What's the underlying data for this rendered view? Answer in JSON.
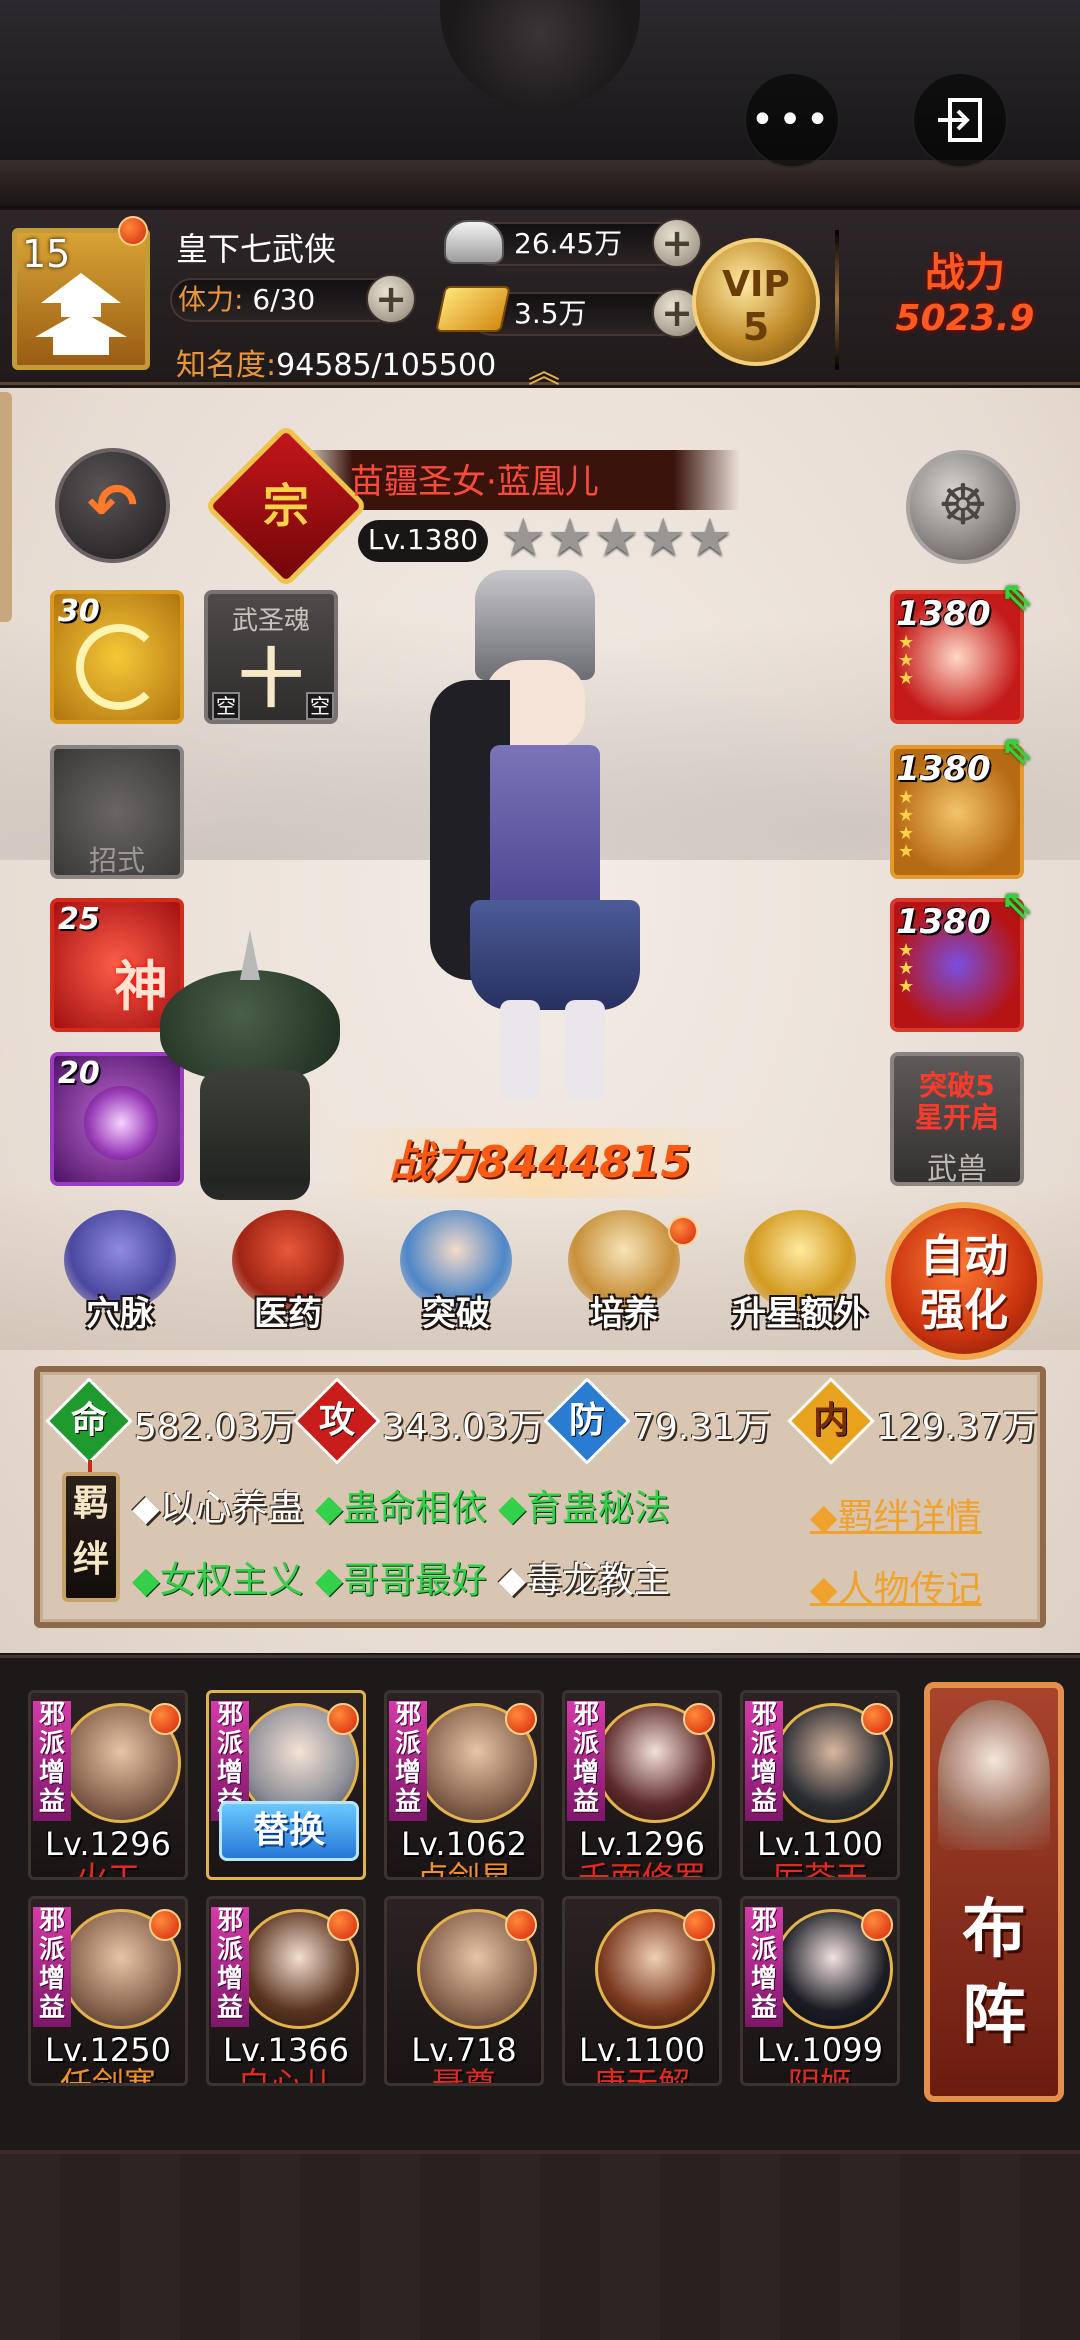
{
  "header": {
    "menu_icon": "more-dots-icon",
    "exit_icon": "exit-icon"
  },
  "player": {
    "level": "15",
    "name": "皇下七武侠",
    "stamina_label": "体力:",
    "stamina": "6/30",
    "fame_label": "知名度:",
    "fame": "94585/105500",
    "silver": "26.45万",
    "gold": "3.5万",
    "vip_label": "VIP",
    "vip_level": "5",
    "power_label": "战力",
    "power_value": "5023.9"
  },
  "hero": {
    "rank_char": "宗",
    "name": "苗疆圣女·蓝凰儿",
    "level": "Lv.1380",
    "stars": [
      "★",
      "★",
      "★",
      "★",
      "★"
    ],
    "combat_power": "战力8444815"
  },
  "left_slots": {
    "slot1_num": "30",
    "soul_title": "武圣魂",
    "soul_char": "十",
    "soul_empty_left": "空",
    "soul_empty_right": "空",
    "move_label": "招式",
    "slot3_num": "25",
    "slot3_char": "神",
    "slot4_num": "20"
  },
  "right_slots": {
    "equip1": "1380",
    "equip2": "1380",
    "equip3": "1380",
    "beast_line1": "突破5",
    "beast_line2": "星开启",
    "beast_label": "武兽"
  },
  "functions": [
    {
      "label": "穴脉"
    },
    {
      "label": "医药"
    },
    {
      "label": "突破"
    },
    {
      "label": "培养"
    },
    {
      "label": "升星额外"
    }
  ],
  "auto_strengthen": {
    "line1": "自动",
    "line2": "强化"
  },
  "stats": {
    "life_char": "命",
    "life": "582.03万",
    "atk_char": "攻",
    "atk": "343.03万",
    "def_char": "防",
    "def": "79.31万",
    "inner_char": "内",
    "inner": "129.37万"
  },
  "bonds": {
    "tag1": "羁",
    "tag2": "绊",
    "row1": [
      {
        "text": "◆以心养蛊",
        "color": "white"
      },
      {
        "text": "◆蛊命相依",
        "color": "green"
      },
      {
        "text": "◆育蛊秘法",
        "color": "green"
      }
    ],
    "row2": [
      {
        "text": "◆女权主义",
        "color": "green"
      },
      {
        "text": "◆哥哥最好",
        "color": "green"
      },
      {
        "text": "◆毒龙教主",
        "color": "white"
      }
    ],
    "detail_link": "◆羁绊详情",
    "bio_link": "◆人物传记"
  },
  "roster": {
    "badge_text": "邪派增益",
    "replace_label": "替换",
    "row1": [
      {
        "level": "Lv.1296",
        "name": "火工",
        "color": "red"
      },
      {
        "level": "",
        "name": "",
        "color": "red"
      },
      {
        "level": "Lv.1062",
        "name": "卢剑星",
        "color": "orange"
      },
      {
        "level": "Lv.1296",
        "name": "千面修罗",
        "color": "red"
      },
      {
        "level": "Lv.1100",
        "name": "厉苍天",
        "color": "red"
      }
    ],
    "row2": [
      {
        "level": "Lv.1250",
        "name": "任剑寒",
        "color": "orange"
      },
      {
        "level": "Lv.1366",
        "name": "白心儿",
        "color": "red"
      },
      {
        "level": "Lv.718",
        "name": "聂尊",
        "color": "red"
      },
      {
        "level": "Lv.1100",
        "name": "唐无解",
        "color": "red"
      },
      {
        "level": "Lv.1099",
        "name": "阴姬",
        "color": "red"
      }
    ],
    "formation_line1": "布",
    "formation_line2": "阵"
  }
}
